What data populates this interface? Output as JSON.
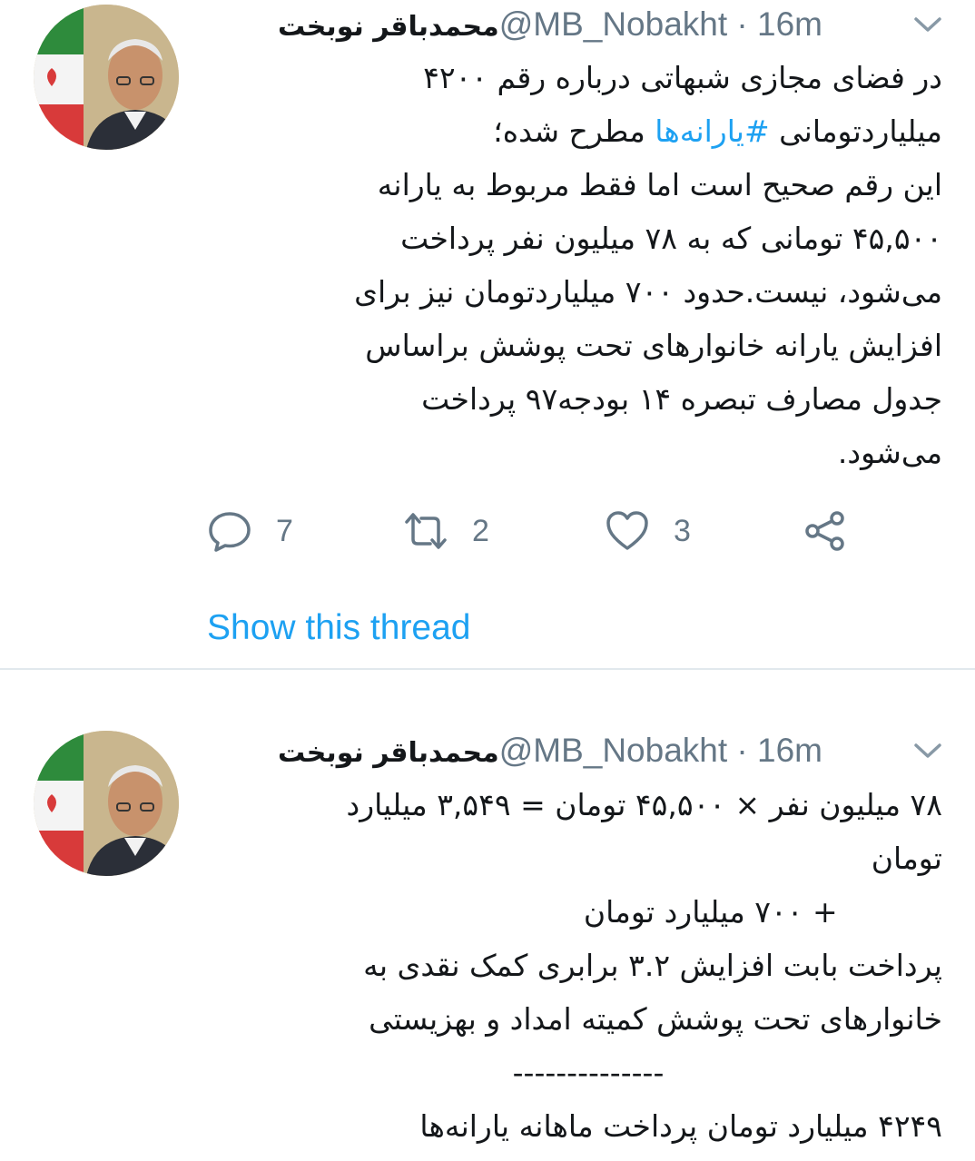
{
  "tweets": [
    {
      "display_name": "محمدباقر نوبخت",
      "handle": "@MB_Nobakht",
      "time": " · 16m",
      "text_before_hashtag": "در فضای مجازی شبهاتی درباره رقم ۴۲۰۰\nمیلیاردتومانی ",
      "hashtag": "#یارانه‌ها",
      "text_after_hashtag": " مطرح شده؛\nاین رقم صحیح است اما فقط مربوط به یارانه\n۴۵,۵۰۰ تومانی که به ۷۸ میلیون نفر پرداخت\nمی‌شود، نیست.حدود ۷۰۰ میلیاردتومان نیز برای\nافزایش یارانه خانوارهای تحت پوشش براساس\nجدول مصارف تبصره ۱۴ بودجه۹۷ پرداخت\nمی‌شود.",
      "reply_count": "7",
      "retweet_count": "2",
      "like_count": "3",
      "show_thread": "Show this thread"
    },
    {
      "display_name": "محمدباقر نوبخت",
      "handle": "@MB_Nobakht",
      "time": " · 16m",
      "text_top": "۷۸ میلیون نفر × ۴۵,۵۰۰ تومان = ۳,۵۴۹ میلیارد\nتومان\n           + ۷۰۰ میلیارد تومان\nپرداخت بابت افزایش ۳.۲ برابری کمک نقدی به\nخانوارهای تحت پوشش کمیته امداد و بهزیستی",
      "separator": "--------------",
      "text_bottom": "۴۲۴۹ میلیارد تومان پرداخت ماهانه یارانه‌ها"
    }
  ],
  "colors": {
    "accent": "#1da1f2",
    "muted": "#657786",
    "text": "#14171a",
    "divider": "#e1e8ed"
  },
  "icons": [
    "reply-icon",
    "retweet-icon",
    "like-icon",
    "share-icon",
    "chevron-down-icon"
  ]
}
